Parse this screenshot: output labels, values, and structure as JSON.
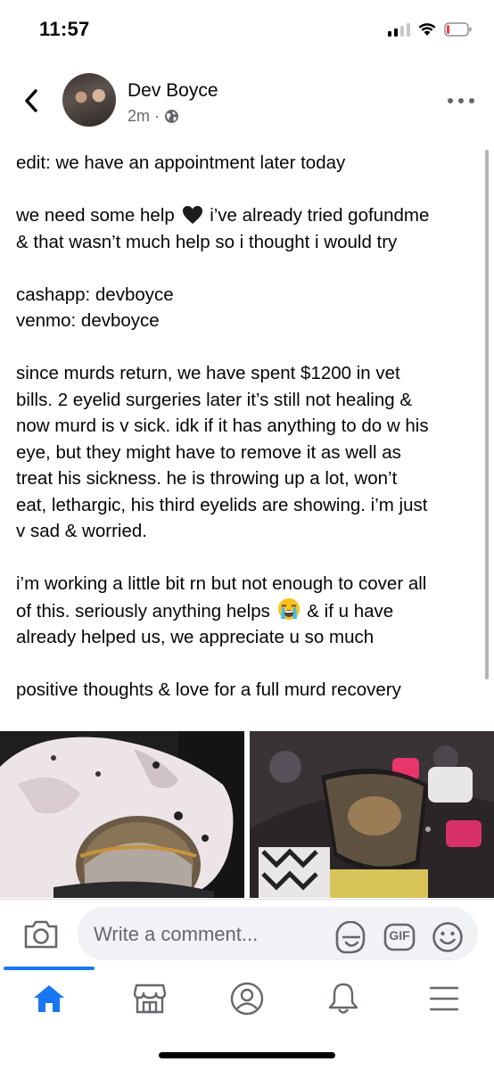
{
  "status_bar": {
    "time": "11:57"
  },
  "post": {
    "author": "Dev Boyce",
    "timestamp": "2m",
    "privacy_separator": "·",
    "paragraphs": [
      [
        "edit: we have an appointment later today"
      ],
      [
        "we need some help",
        "i’ve already tried gofundme",
        "& that wasn’t much help so i thought i would try"
      ],
      [
        "cashapp: devboyce",
        "venmo: devboyce"
      ],
      [
        "since murds return, we have spent $1200 in vet",
        "bills. 2 eyelid surgeries later it’s still not healing &",
        "now murd is v sick. idk if it has anything to do w his",
        "eye, but they might have to remove it as well as",
        "treat his sickness. he is throwing up a lot, won’t",
        "eat, lethargic, his third eyelids are showing. i’m just",
        "v sad & worried."
      ],
      [
        "i’m working a little bit rn but not enough to cover all",
        "of this. seriously anything helps",
        "& if u have",
        "already helped us, we appreciate u so much"
      ],
      [
        "positive thoughts & love for a full murd recovery"
      ]
    ],
    "emojis": {
      "black_heart": "black-heart-icon",
      "crying_face": "loudly-crying-face-icon"
    },
    "photos": [
      {
        "name": "cat-photo-1"
      },
      {
        "name": "cat-photo-2"
      }
    ]
  },
  "comment_bar": {
    "placeholder": "Write a comment...",
    "gif_label": "GIF"
  },
  "nav": {
    "items": [
      "home-icon",
      "marketplace-icon",
      "profile-icon",
      "notifications-icon",
      "menu-icon"
    ],
    "active": "home",
    "accent": "#1877f2"
  },
  "colors": {
    "accent": "#1877f2",
    "secondary_text": "#65676b",
    "input_bg": "#f0f2f5"
  }
}
